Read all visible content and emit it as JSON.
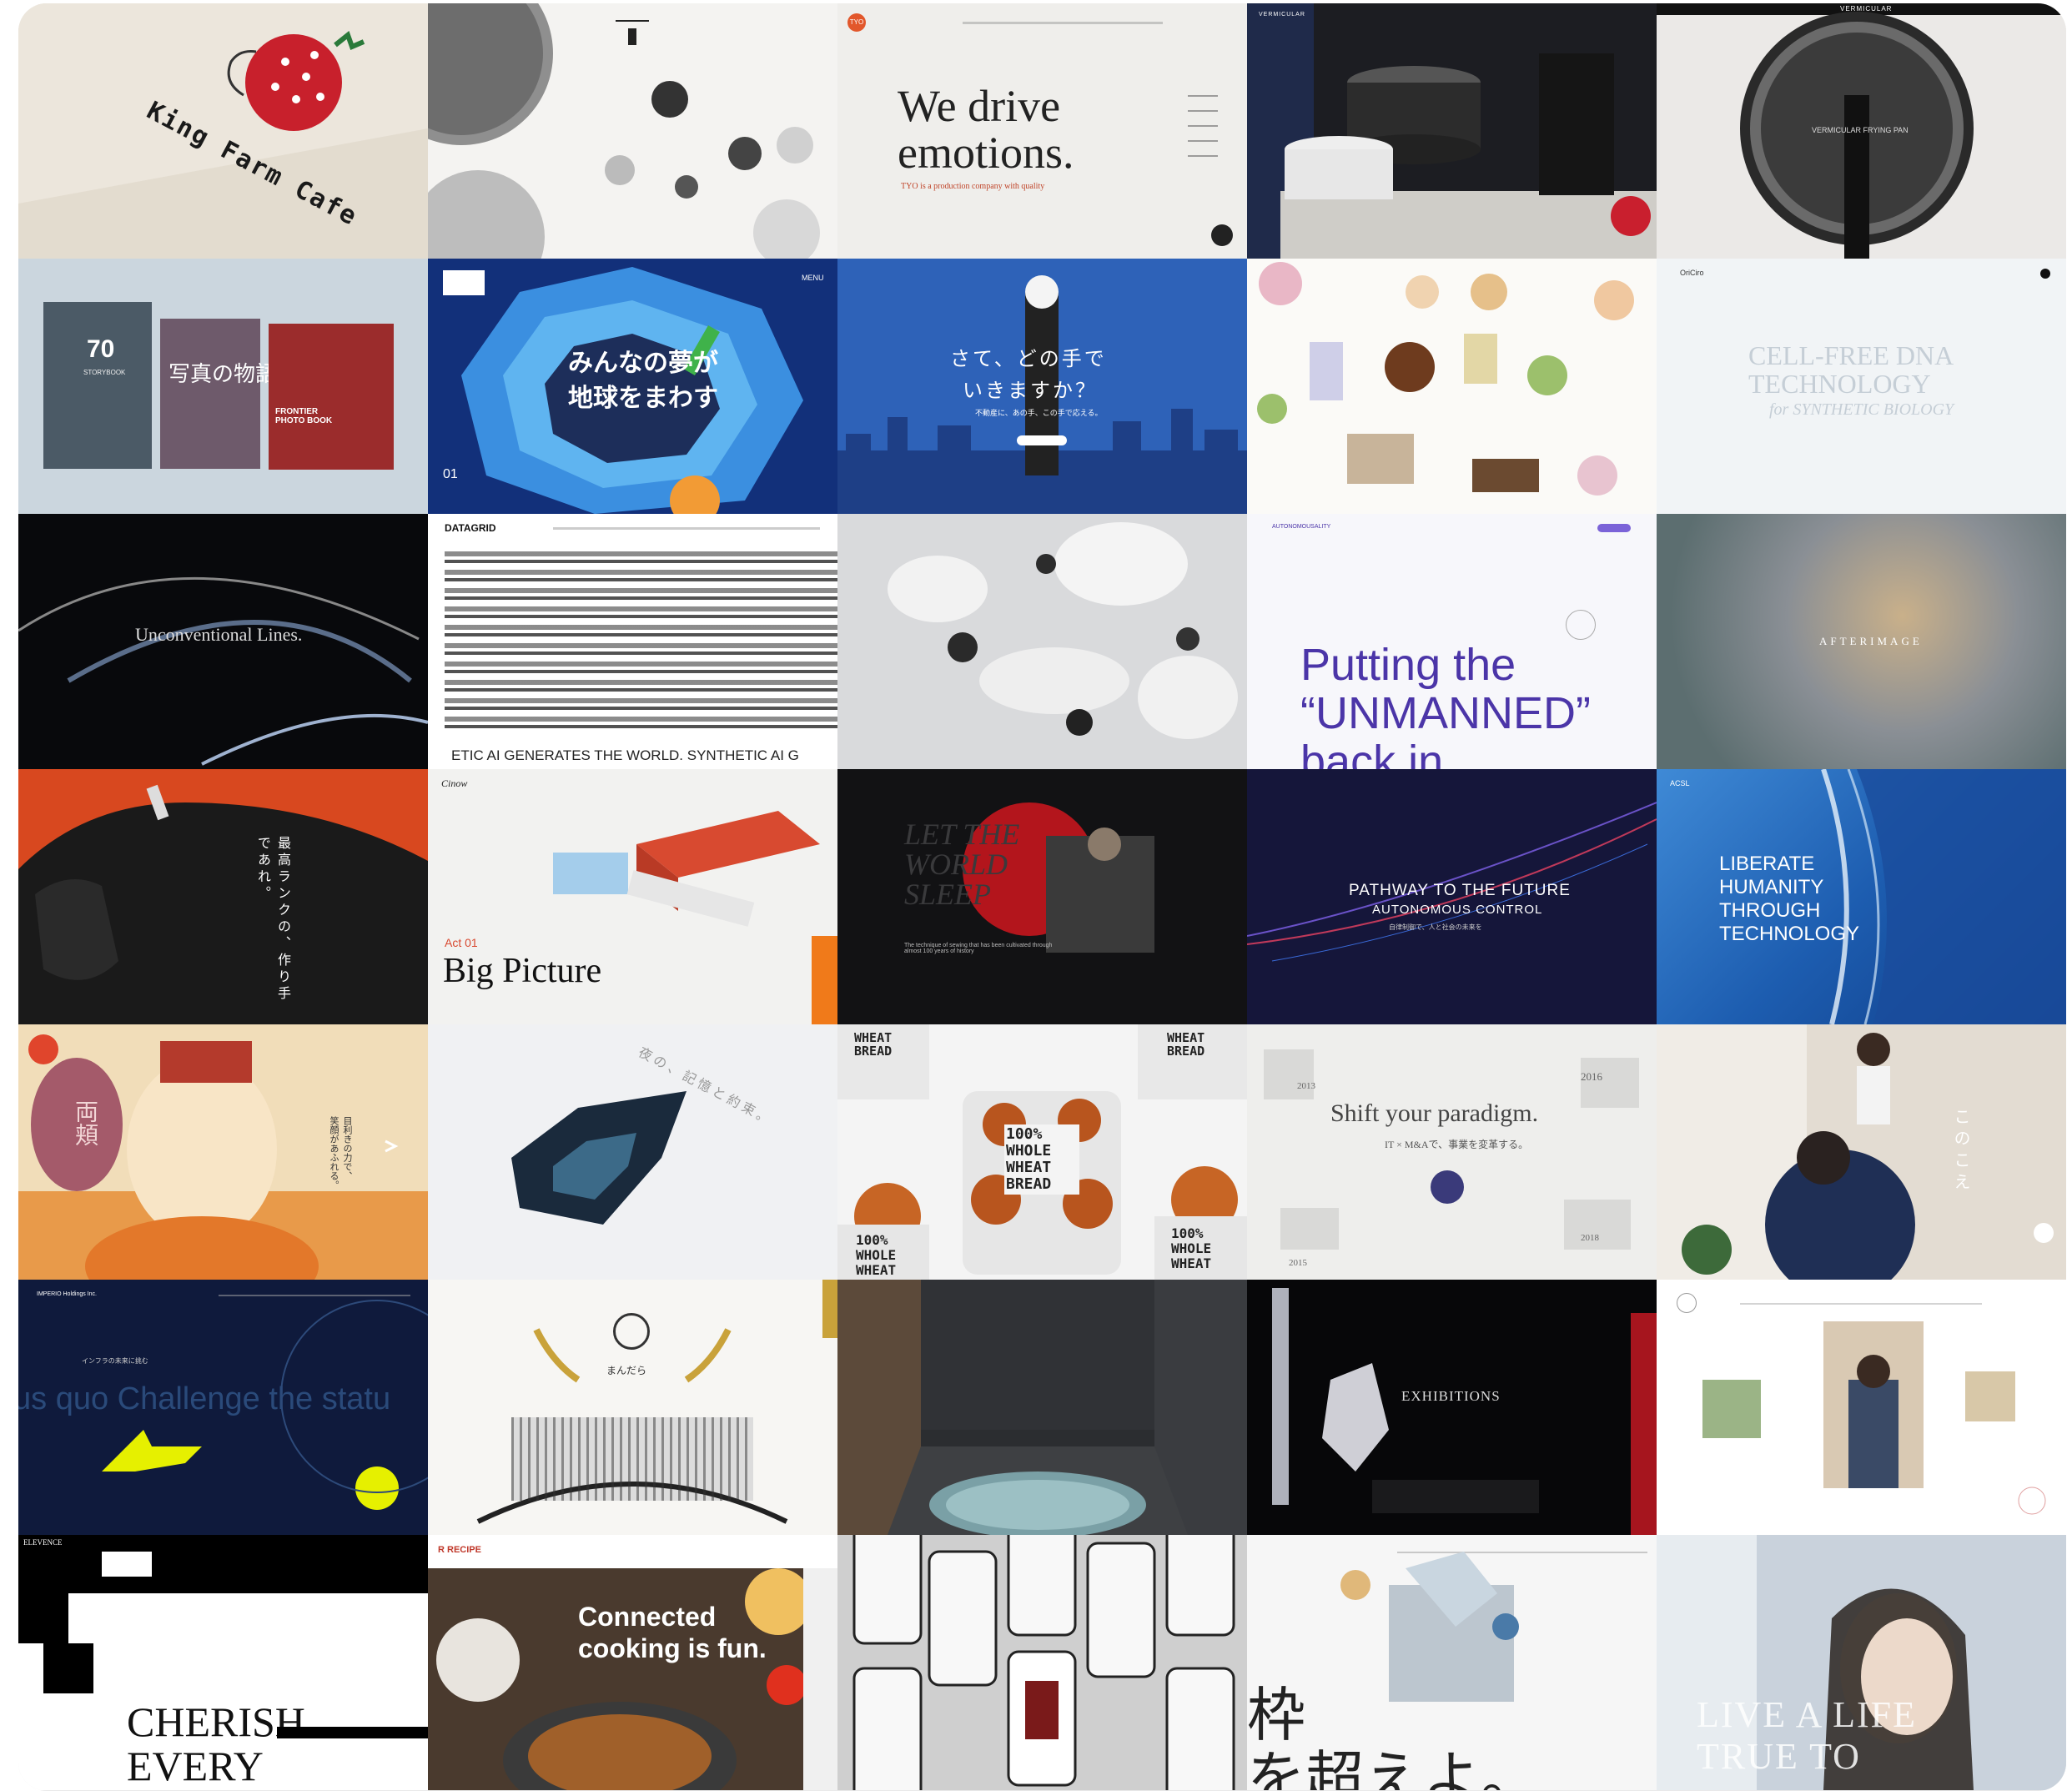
{
  "tiles": {
    "t01": {
      "text": "King Farm Cafe",
      "bg": "#ece6dc",
      "accent": "#c8202c"
    },
    "t02": {
      "bg": "#f4f3f1"
    },
    "t03": {
      "headline_line1": "We drive",
      "headline_line2": "emotions.",
      "sub": "TYO is a production company with quality",
      "logo": "TYO",
      "bg": "#efeeeb"
    },
    "t04": {
      "brand": "VERMICULAR",
      "bg": "#1c1d22"
    },
    "t05": {
      "brand": "VERMICULAR",
      "product": "VERMICULAR FRYING PAN",
      "bg": "#ebe9e7"
    },
    "t06": {
      "book1_title": "70",
      "book1_sub": "STORYBOOK",
      "book2_title": "写真の物語",
      "book3_title": "FRONTIER PHOTO BOOK",
      "bg": "#cbd6de"
    },
    "t07": {
      "line1": "みんなの夢が",
      "line2": "地球をまわす",
      "page": "01",
      "menu": "MENU",
      "bg": "#1a3a8a"
    },
    "t08": {
      "line1": "さて、どの手で",
      "line2": "いきますか？",
      "sub": "不動産に、あの手、この手で応える。",
      "bg": "#2a5cb0"
    },
    "t09": {
      "bg": "#fbfaf7"
    },
    "t10": {
      "line1": "CELL-FREE DNA",
      "line2": "TECHNOLOGY",
      "line3": "for SYNTHETIC BIOLOGY",
      "logo": "OriCiro",
      "bg": "#f1f4f6"
    },
    "t11": {
      "headline": "Unconventional Lines.",
      "bg": "#08090c"
    },
    "t12": {
      "logo": "DATAGRID",
      "ticker": "ETIC AI GENERATES THE WORLD. SYNTHETIC AI G",
      "bg": "#ffffff"
    },
    "t13": {
      "bg": "#d9dadc"
    },
    "t14": {
      "line1": "Putting the",
      "line2": "“UNMANNED”",
      "line3": "back in",
      "logo": "AUTONOMOUSALITY",
      "bg": "#f7f7fb",
      "accent": "#4b35a8"
    },
    "t15": {
      "title": "AFTERIMAGE",
      "bg": "#9aa0a8"
    },
    "t16": {
      "text": "最高ランクの、作り手であれ。",
      "bg": "#d8481f"
    },
    "t17": {
      "act": "Act 01",
      "headline": "Big Picture",
      "logo": "Cinow",
      "bg": "#f2f2f0"
    },
    "t18": {
      "bg_text": "LET THE WORLD SLEEP",
      "sub": "The technique of sewing that has been cultivated through almost 100 years of history",
      "bg": "#121214"
    },
    "t19": {
      "line1": "PATHWAY TO THE FUTURE",
      "line2": "AUTONOMOUS CONTROL",
      "sub": "自律制御で、人と社会の未来を",
      "bg": "#15163a"
    },
    "t20": {
      "line1": "LIBERATE",
      "line2": "HUMANITY",
      "line3": "THROUGH",
      "line4": "TECHNOLOGY",
      "logo": "ACSL",
      "bg": "#2a6fc4"
    },
    "t21": {
      "text1": "目利きの力で、",
      "text2": "笑顔があふれる。",
      "fan": "両頬",
      "bg": "#f1ddb9"
    },
    "t22": {
      "text": "夜の、記憶と約束。",
      "bg": "#f0f1f3"
    },
    "t23": {
      "bag1": "100% WHOLE WHEAT BREAD",
      "bag2": "WHEAT BREAD",
      "bag3": "100% WHOLE WHEAT BREAD",
      "bag4": "100% WHOLE WHEAT",
      "bag5": "100% WHOLE WHEAT",
      "bg": "#f4f4f4"
    },
    "t24": {
      "headline": "Shift your paradigm.",
      "sub": "IT × M&Aで、事業を変革する。",
      "y1": "2016",
      "y2": "2013",
      "y3": "2018",
      "y4": "2015",
      "bg": "#eeeeec"
    },
    "t25": {
      "text": "このこえ",
      "bg": "#d6cfc6"
    },
    "t26": {
      "marquee": "us quo Challenge the statu",
      "logo": "IMPERIO Holdings Inc.",
      "sub": "インフラの未来に挑む",
      "bg": "#0f1a3c",
      "accent": "#e6f000"
    },
    "t27": {
      "logo_text": "まんだら",
      "bg": "#f7f6f3"
    },
    "t28": {
      "bg": "#2b2d30"
    },
    "t29": {
      "headline": "EXHIBITIONS",
      "bg": "#070709"
    },
    "t30": {
      "bg": "#ffffff"
    },
    "t31": {
      "logo": "ELEVENCE",
      "line1": "CHERISH",
      "line2": "EVERY",
      "bg": "#ffffff"
    },
    "t32": {
      "logo": "R RECIPE",
      "line1": "Connected",
      "line2": "cooking is fun.",
      "bg": "#3a2a20"
    },
    "t33": {
      "bg": "#cfcfcf"
    },
    "t34": {
      "headline_line1": "枠",
      "headline_line2": "を超えよ。",
      "bg": "#f6f6f6"
    },
    "t35": {
      "line1": "LIVE A LIFE",
      "line2": "TRUE TO",
      "bg": "#d9dde4"
    }
  }
}
